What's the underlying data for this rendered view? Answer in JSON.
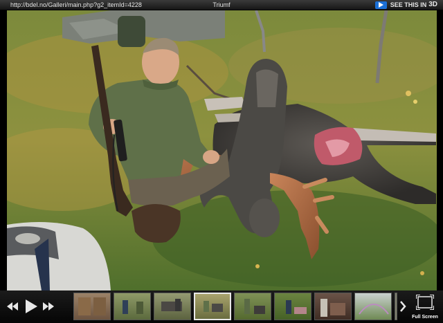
{
  "window": {
    "url": "http://bdel.no/Galleri/main.php?g2_itemId=4228",
    "title": "Triumf",
    "promo_label": "SEE THIS IN",
    "promo_3d": "3D"
  },
  "photo": {
    "description": "Hunter kneeling with rifle next to a felled moose in an autumn field"
  },
  "controls": {
    "rewind_icon": "rewind-icon",
    "play_icon": "play-icon",
    "forward_icon": "fast-forward-icon",
    "next_icon": "chevron-right-icon",
    "fullscreen_icon": "fullscreen-icon",
    "fullscreen_label": "Full Screen"
  },
  "thumbnails": [
    {
      "name": "thumbnail-1",
      "selected": false
    },
    {
      "name": "thumbnail-2",
      "selected": false
    },
    {
      "name": "thumbnail-3",
      "selected": false
    },
    {
      "name": "thumbnail-4",
      "selected": true
    },
    {
      "name": "thumbnail-5",
      "selected": false
    },
    {
      "name": "thumbnail-6",
      "selected": false
    },
    {
      "name": "thumbnail-7",
      "selected": false
    },
    {
      "name": "thumbnail-8",
      "selected": false
    },
    {
      "name": "thumbnail-9",
      "selected": false
    }
  ],
  "colors": {
    "background": "#000000",
    "promo_blue": "#1a6fd6",
    "selected_border": "#e8e8e8"
  }
}
